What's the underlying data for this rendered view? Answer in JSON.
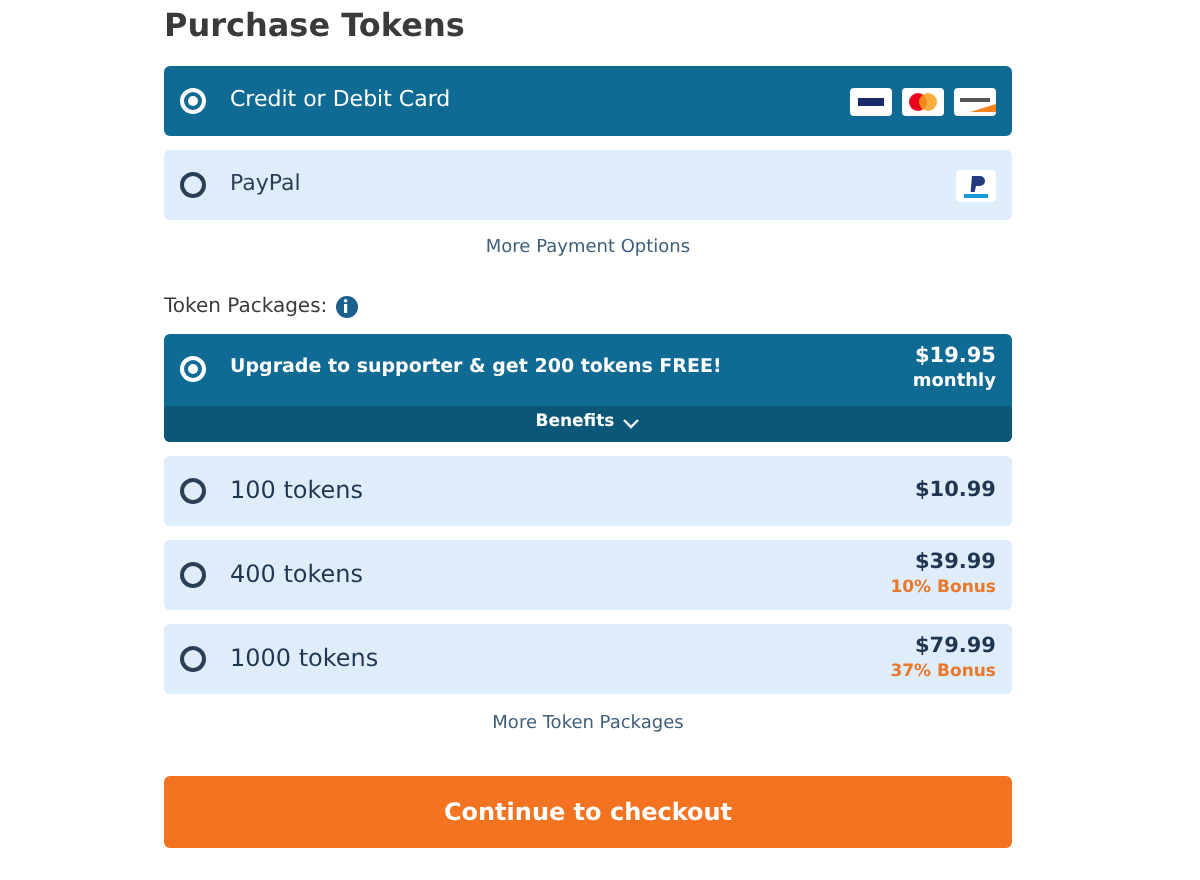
{
  "title": "Purchase Tokens",
  "payment_options": [
    {
      "kind": "card",
      "label": "Credit or Debit Card",
      "selected": true
    },
    {
      "kind": "paypal",
      "label": "PayPal",
      "selected": false
    }
  ],
  "more_payment_link": "More Payment Options",
  "packages_label": "Token Packages:",
  "packages": [
    {
      "kind": "supporter",
      "label": "Upgrade to supporter & get 200 tokens FREE!",
      "price": "$19.95",
      "period": "monthly",
      "benefits": "Benefits",
      "selected": true
    },
    {
      "kind": "tokens",
      "label": "100 tokens",
      "price": "$10.99",
      "selected": false
    },
    {
      "kind": "tokens",
      "label": "400 tokens",
      "price": "$39.99",
      "bonus": "10% Bonus",
      "selected": false
    },
    {
      "kind": "tokens",
      "label": "1000 tokens",
      "price": "$79.99",
      "bonus": "37% Bonus",
      "selected": false
    }
  ],
  "more_packages_link": "More Token Packages",
  "checkout_button": "Continue to checkout"
}
